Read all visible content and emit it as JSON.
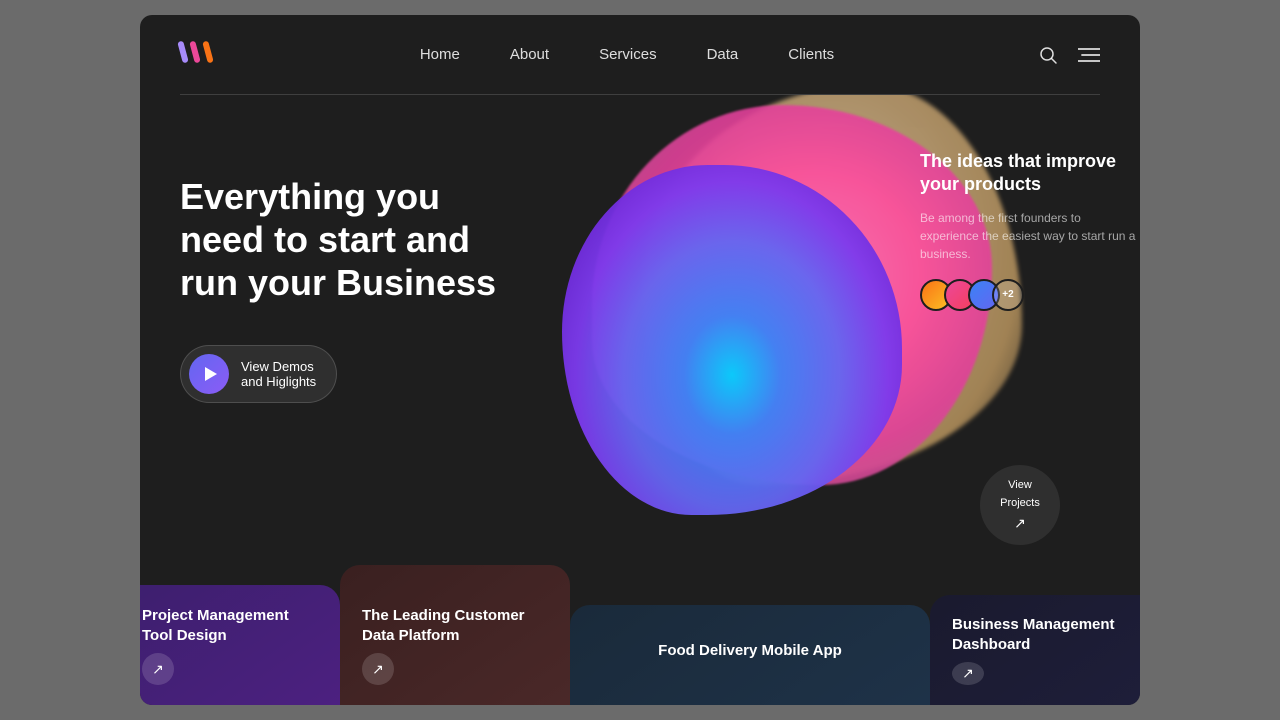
{
  "meta": {
    "bg_color": "#6b6b6b",
    "window_bg": "#1e1e1e"
  },
  "navbar": {
    "logo_alt": "Brand Logo",
    "nav_items": [
      {
        "label": "Home",
        "id": "home"
      },
      {
        "label": "About",
        "id": "about"
      },
      {
        "label": "Services",
        "id": "services"
      },
      {
        "label": "Data",
        "id": "data"
      },
      {
        "label": "Clients",
        "id": "clients"
      }
    ]
  },
  "hero": {
    "heading": "Everything you need to start and run your Business",
    "cta_label_line1": "View Demos",
    "cta_label_line2": "and Higlights"
  },
  "right_card": {
    "title": "The ideas that improve your products",
    "description": "Be among the first founders to experience the easiest way to start run a business.",
    "avatar_extra": "+2"
  },
  "view_projects": {
    "label_line1": "View",
    "label_line2": "Projects"
  },
  "bottom_cards": [
    {
      "id": "project-mgmt",
      "title": "Project Management Tool Design",
      "has_arrow": true
    },
    {
      "id": "customer-data",
      "title": "The Leading Customer Data Platform",
      "has_arrow": true
    },
    {
      "id": "food-delivery",
      "title": "Food Delivery Mobile App",
      "has_arrow": false
    },
    {
      "id": "business-mgmt",
      "title": "Business Management Dashboard",
      "has_arrow": true
    }
  ]
}
